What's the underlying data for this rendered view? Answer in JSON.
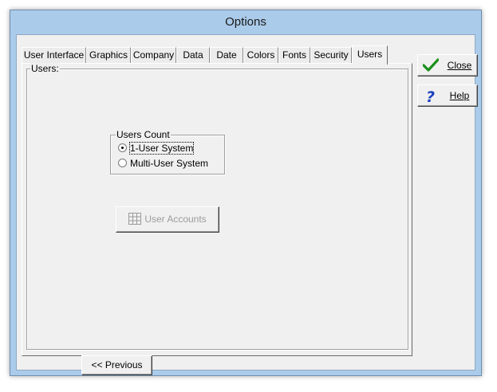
{
  "window": {
    "title": "Options"
  },
  "tabs": [
    {
      "label": "User Interface",
      "active": false
    },
    {
      "label": "Graphics",
      "active": false
    },
    {
      "label": "Company",
      "active": false
    },
    {
      "label": "Data",
      "active": false
    },
    {
      "label": "Date",
      "active": false
    },
    {
      "label": "Colors",
      "active": false
    },
    {
      "label": "Fonts",
      "active": false
    },
    {
      "label": "Security",
      "active": false
    },
    {
      "label": "Users",
      "active": true
    }
  ],
  "page": {
    "frame_label": "Users:",
    "users_count": {
      "legend": "Users Count",
      "options": [
        {
          "label": "1-User System",
          "selected": true
        },
        {
          "label": "Multi-User System",
          "selected": false
        }
      ]
    },
    "user_accounts_button": {
      "label": "User Accounts",
      "enabled": false,
      "icon": "users-grid-icon"
    }
  },
  "buttons": {
    "close": {
      "label": "Close",
      "icon": "checkmark-icon",
      "accent": "#1a8f1a"
    },
    "help": {
      "label": "Help",
      "icon": "question-icon",
      "accent": "#1d3fbf"
    },
    "previous": {
      "label": "<< Previous"
    }
  }
}
